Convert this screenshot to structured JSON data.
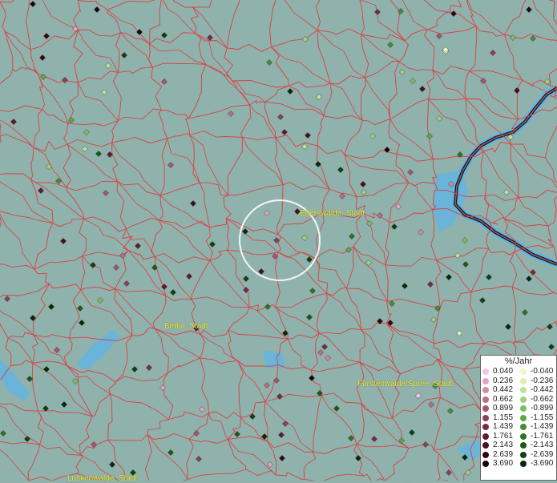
{
  "map": {
    "labels": {
      "eberswalde": "Eberswalde, Stadt",
      "berlin": "Berlin, Stadt",
      "fuerstenwalde": "Fürstenwalde/Spree, Stadt",
      "luckenwalde": "Luckenwalde, Stadt"
    },
    "colors": {
      "background": "#8fb2ad",
      "boundary": "#d94040",
      "water": "#5fb4e8",
      "river_outline": "#2b1010",
      "highlight_circle": "#ffffff"
    }
  },
  "legend": {
    "title": "%/Jahr",
    "rows": [
      {
        "pos": "0.040",
        "pos_color": "#f7c4ea",
        "neg": "-0.040",
        "neg_color": "#f2f7c8"
      },
      {
        "pos": "0.236",
        "pos_color": "#e3a3c7",
        "neg": "-0.236",
        "neg_color": "#ddeeb0"
      },
      {
        "pos": "0.442",
        "pos_color": "#d189a8",
        "neg": "-0.442",
        "neg_color": "#bfe09a"
      },
      {
        "pos": "0.662",
        "pos_color": "#bc6c8a",
        "neg": "-0.662",
        "neg_color": "#9ed27f"
      },
      {
        "pos": "0.899",
        "pos_color": "#a75570",
        "neg": "-0.899",
        "neg_color": "#7ebe62"
      },
      {
        "pos": "1.155",
        "pos_color": "#903f58",
        "neg": "-1.155",
        "neg_color": "#5ea84a"
      },
      {
        "pos": "1.439",
        "pos_color": "#792b42",
        "neg": "-1.439",
        "neg_color": "#438f36"
      },
      {
        "pos": "1.761",
        "pos_color": "#611b2f",
        "neg": "-1.761",
        "neg_color": "#2d7426"
      },
      {
        "pos": "2.143",
        "pos_color": "#4a0f20",
        "neg": "-2.143",
        "neg_color": "#1c5a1a"
      },
      {
        "pos": "2.639",
        "pos_color": "#340714",
        "neg": "-2.639",
        "neg_color": "#0f4210"
      },
      {
        "pos": "3.690",
        "pos_color": "#20020a",
        "neg": "-3.690",
        "neg_color": "#062b08"
      }
    ]
  }
}
